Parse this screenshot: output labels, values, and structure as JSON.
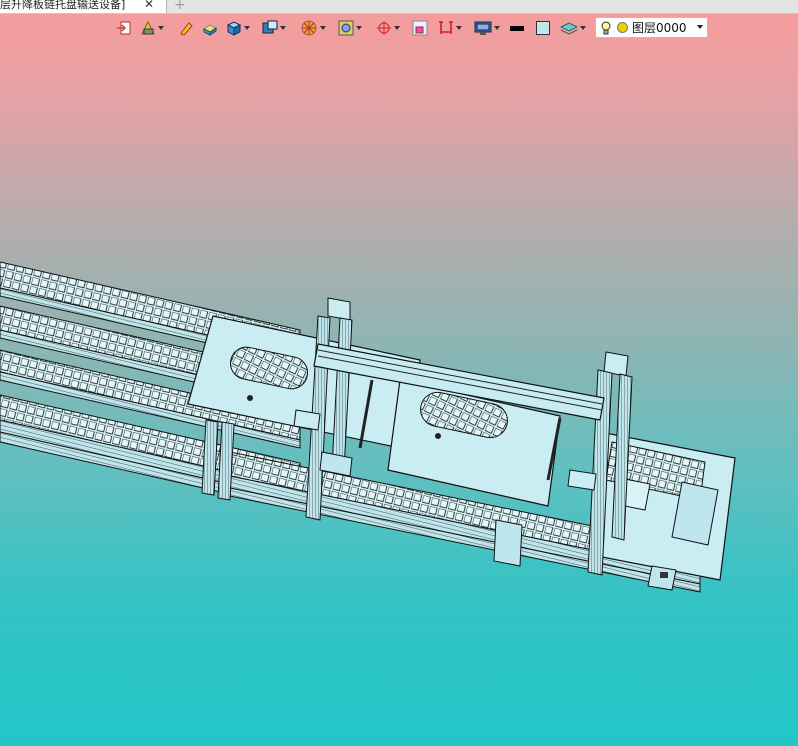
{
  "tabs": [
    {
      "title": "层升降板链托盘输送设备]",
      "close_glyph": "✕",
      "active": true
    }
  ],
  "new_tab_glyph": "+",
  "toolbar": {
    "tools": [
      {
        "icon": "exit-sketch-icon",
        "dropdown": false
      },
      {
        "icon": "sketch-tools-icon",
        "dropdown": true
      },
      {
        "icon": "pencil-icon",
        "dropdown": false
      },
      {
        "icon": "eraser-box-icon",
        "dropdown": false
      },
      {
        "icon": "solid-box-icon",
        "dropdown": true
      },
      {
        "icon": "view-cube-icon",
        "dropdown": true
      },
      {
        "icon": "render-mode-icon",
        "dropdown": true
      },
      {
        "icon": "section-view-icon",
        "dropdown": true
      },
      {
        "icon": "orient-axes-icon",
        "dropdown": true
      },
      {
        "icon": "select-filter-icon",
        "dropdown": false
      },
      {
        "icon": "measure-icon",
        "dropdown": true
      },
      {
        "icon": "display-settings-icon",
        "dropdown": true
      },
      {
        "icon": "line-color-icon",
        "dropdown": false
      },
      {
        "icon": "fill-color-icon",
        "dropdown": false
      },
      {
        "icon": "layer-stack-icon",
        "dropdown": true
      }
    ],
    "colors": {
      "line": "#000000",
      "fill": "#bfe6ef"
    }
  },
  "layer": {
    "name": "图层0000",
    "visible_icon": "lightbulb-icon",
    "color": "#e8d400"
  },
  "viewport": {
    "background_top": "#f89c9c",
    "background_bottom": "#22c6c8",
    "model_color": "#c6ecf2",
    "model_edge_color": "#1a1a1a"
  }
}
